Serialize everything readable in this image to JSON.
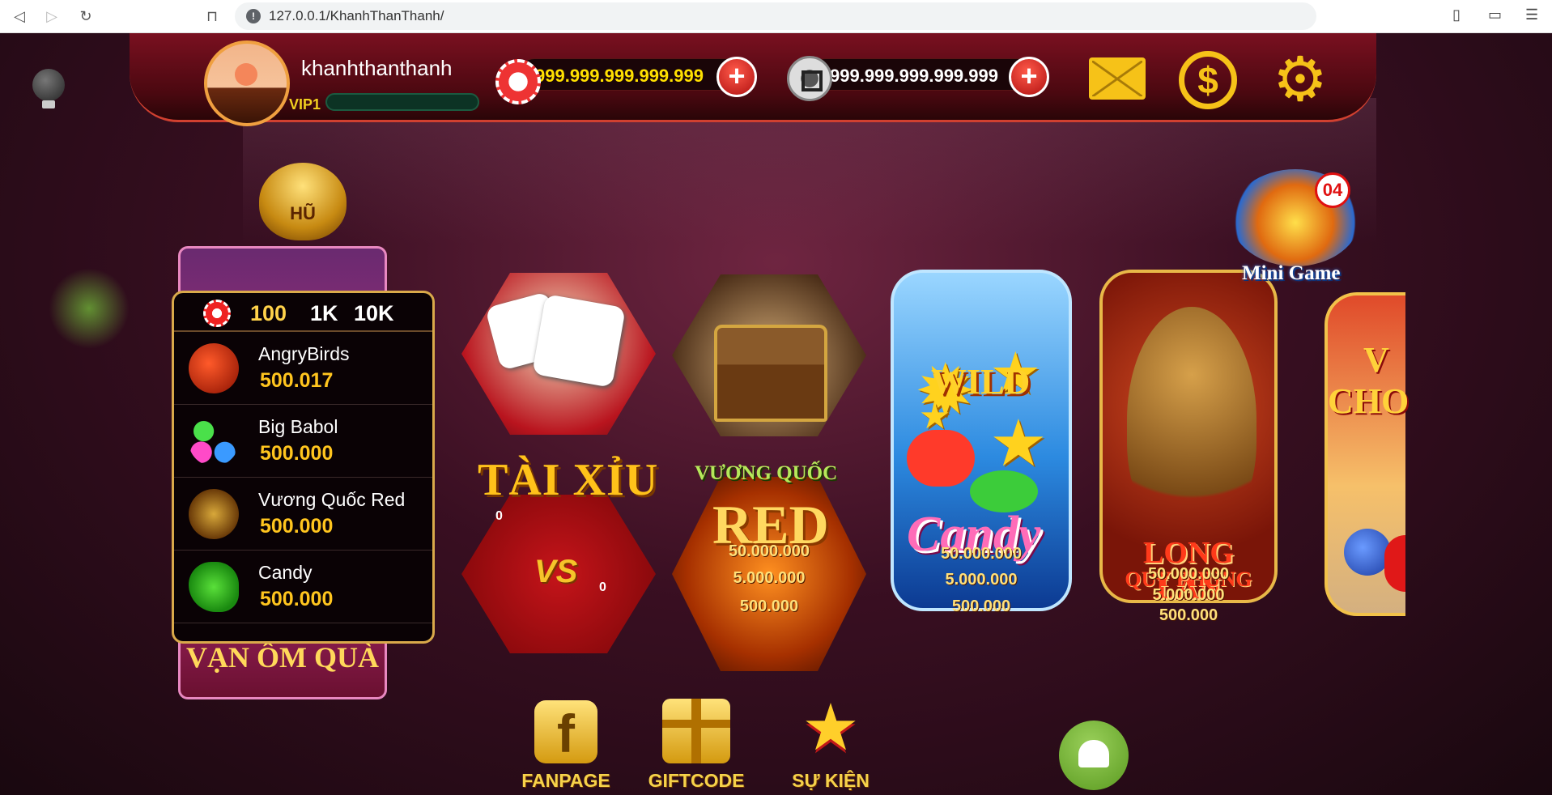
{
  "browser": {
    "url": "127.0.0.1/KhanhThanThanh/"
  },
  "profile": {
    "username": "khanhthanthanh",
    "vip_label": "VIP1",
    "vip_progress": 0
  },
  "balances": {
    "chip": "999.999.999.999.999",
    "silver": "999.999.999.999.999"
  },
  "header_icons": [
    "mail-icon",
    "coin-exchange-icon",
    "settings-gear-icon"
  ],
  "jackpot": {
    "pot_label": "HŨ",
    "banner_text": "VẠN ÔM QUÀ",
    "denominations": [
      "100",
      "1K",
      "10K"
    ],
    "selected_denomination": "100",
    "entries": [
      {
        "name": "AngryBirds",
        "amount": "500.017"
      },
      {
        "name": "Big Babol",
        "amount": "500.000"
      },
      {
        "name": "Vương Quốc Red",
        "amount": "500.000"
      },
      {
        "name": "Candy",
        "amount": "500.000"
      }
    ]
  },
  "games": {
    "taixiu": {
      "title": "TÀI XỈU",
      "vs": "VS",
      "left_count": "0",
      "right_count": "0"
    },
    "vuongquoc": {
      "subtitle": "VƯƠNG QUỐC",
      "title": "RED",
      "jackpots": [
        "50.000.000",
        "5.000.000",
        "500.000"
      ]
    },
    "candy": {
      "badge": "WILD",
      "title": "Candy",
      "jackpots": [
        "50.000.000",
        "5.000.000",
        "500.000"
      ]
    },
    "longlan": {
      "title": "LONG LÂN",
      "subtitle": "QUY PHỤNG",
      "jackpots": [
        "50.000.000",
        "5.000.000",
        "500.000"
      ]
    },
    "partial": {
      "title": "V\nCHO"
    }
  },
  "minigame": {
    "label": "Mini Game",
    "badge": "04"
  },
  "bottom_bar": {
    "fanpage": "FANPAGE",
    "giftcode": "GIFTCODE",
    "event": "SỰ KIỆN"
  },
  "colors": {
    "accent_gold": "#f6c218",
    "jackpot_amount": "#ffc51e",
    "topbar_red": "#7a1020"
  }
}
